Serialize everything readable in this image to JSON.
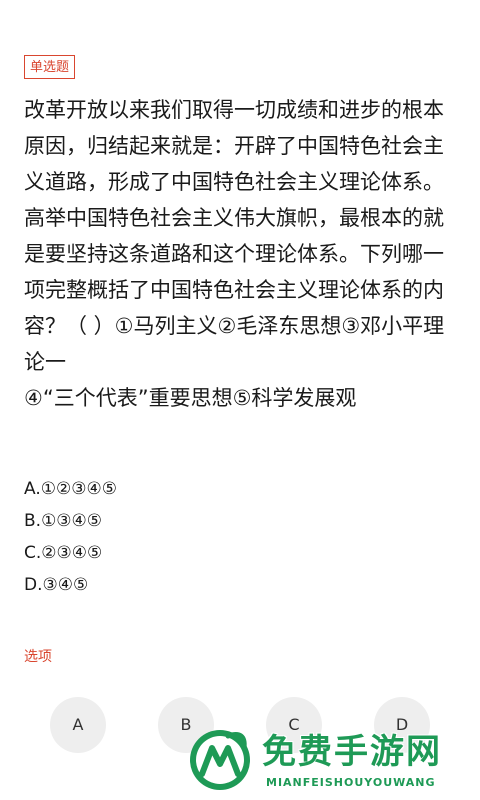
{
  "question_type_label": "单选题",
  "question_text": "改革开放以来我们取得一切成绩和进步的根本原因，归结起来就是：开辟了中国特色社会主义道路，形成了中国特色社会主义理论体系。高举中国特色社会主义伟大旗帜，最根本的就是要坚持这条道路和这个理论体系。下列哪一项完整概括了中国特色社会主义理论体系的内容？（ ）①马列主义②毛泽东思想③邓小平理论一\n④“三个代表”重要思想⑤科学发展观",
  "options": [
    "A.①②③④⑤",
    "B.①③④⑤",
    "C.②③④⑤",
    "D.③④⑤"
  ],
  "answer_section_label": "选项",
  "answer_buttons": [
    "A",
    "B",
    "C",
    "D"
  ],
  "watermark": {
    "title": "免费手游网",
    "subtitle": "MIANFEISHOUYOUWANG",
    "brand_color": "#1e9a56"
  },
  "colors": {
    "accent": "#d9462f",
    "text": "#1a1a1a",
    "button_bg": "#eeeeee"
  }
}
